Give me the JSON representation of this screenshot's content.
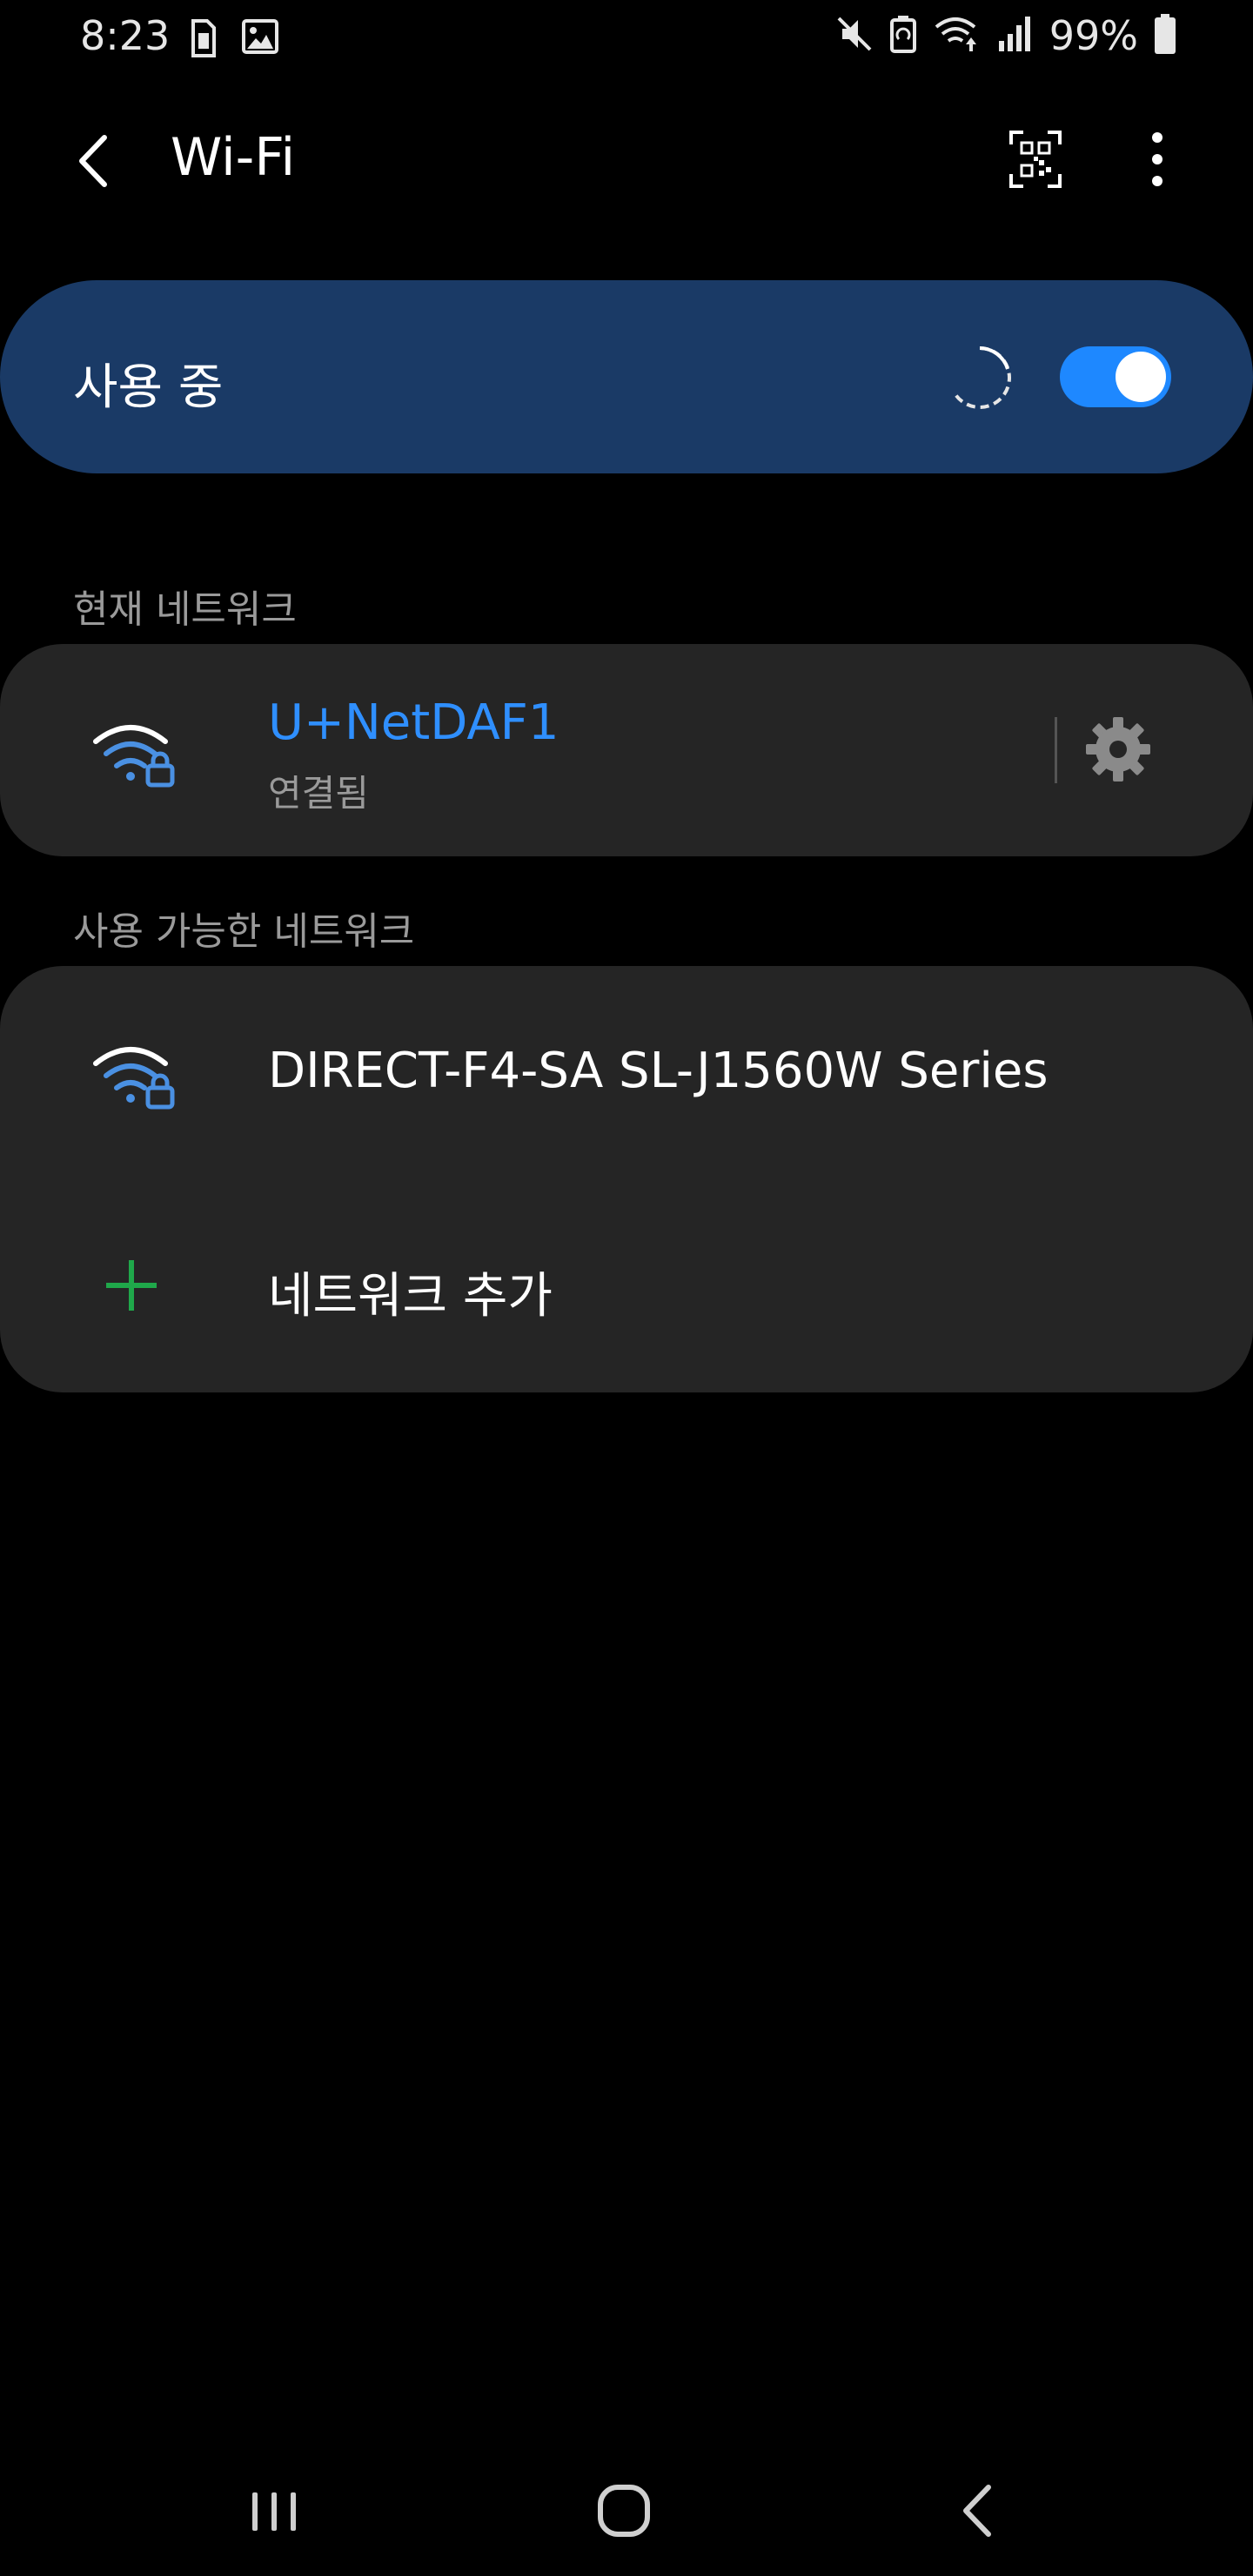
{
  "status_bar": {
    "time": "8:23",
    "battery_percent": "99%",
    "icons": [
      "sim-card-icon",
      "image-icon",
      "mute-icon",
      "battery-saver-icon",
      "wifi-data-icon",
      "signal-icon",
      "battery-icon"
    ]
  },
  "header": {
    "title": "Wi-Fi",
    "icons": [
      "back-icon",
      "qr-code-icon",
      "more-vert-icon"
    ]
  },
  "master_switch": {
    "label": "사용 중",
    "enabled": true,
    "accent_color": "#1e88ff",
    "card_color": "#1a3a66"
  },
  "current_network": {
    "section_title": "현재 네트워크",
    "name": "U+NetDAF1",
    "status": "연결됨",
    "name_color": "#2f8fff"
  },
  "available_networks": {
    "section_title": "사용 가능한 네트워크",
    "items": [
      {
        "name": "DIRECT-F4-SA SL-J1560W Series",
        "secured": true
      }
    ],
    "add_label": "네트워크 추가",
    "add_icon_color": "#1fa84a"
  },
  "nav_bar": {
    "icons": [
      "recents-icon",
      "home-icon",
      "back-nav-icon"
    ]
  }
}
